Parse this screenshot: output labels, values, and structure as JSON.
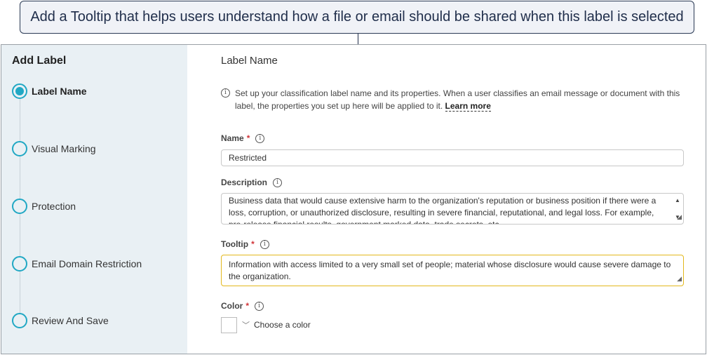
{
  "callout": {
    "text": "Add a Tooltip that helps users understand how a file or email should be shared when this label is selected"
  },
  "sidebar": {
    "title": "Add Label",
    "steps": [
      {
        "label": "Label Name",
        "active": true
      },
      {
        "label": "Visual Marking",
        "active": false
      },
      {
        "label": "Protection",
        "active": false
      },
      {
        "label": "Email Domain Restriction",
        "active": false
      },
      {
        "label": "Review And Save",
        "active": false
      }
    ]
  },
  "main": {
    "title": "Label Name",
    "info_text": "Set up your classification label name and its properties. When a user classifies an email message or document with this label, the properties you set up here will be applied to it.",
    "learn_more": "Learn more",
    "name": {
      "label": "Name",
      "required": "*",
      "value": "Restricted"
    },
    "description": {
      "label": "Description",
      "value": "Business data that would cause extensive harm to the organization's reputation or business position if there were a loss, corruption, or unauthorized disclosure, resulting in severe financial, reputational, and legal loss. For example, pre-release financial results, government marked data, trade secrets, etc."
    },
    "tooltip": {
      "label": "Tooltip",
      "required": "*",
      "value": "Information with access limited to a very small set of people; material whose disclosure would cause severe damage to the organization."
    },
    "color": {
      "label": "Color",
      "required": "*",
      "placeholder": "Choose a color"
    }
  },
  "colors": {
    "accent": "#21a8c4",
    "sidebar_bg": "#e9f0f4",
    "required": "#d13438",
    "focus_border": "#e3b81d"
  }
}
